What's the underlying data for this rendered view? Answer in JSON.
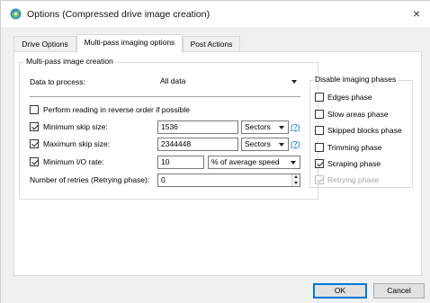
{
  "window": {
    "title": "Options (Compressed drive image creation)",
    "close_glyph": "×",
    "icon": "app-icon"
  },
  "tabs": [
    {
      "label": "Drive Options",
      "active": false
    },
    {
      "label": "Multi-pass imaging options",
      "active": true
    },
    {
      "label": "Post Actions",
      "active": false
    }
  ],
  "multipass": {
    "group_title": "Multi-pass image creation",
    "data_to_process_label": "Data to process:",
    "data_to_process_value": "All data",
    "reverse_order_label": "Perform reading in reverse order if possible",
    "reverse_order_checked": false,
    "min_skip": {
      "label": "Minimum skip size:",
      "checked": true,
      "value": "1536",
      "unit": "Sectors",
      "help": "(?)"
    },
    "max_skip": {
      "label": "Maximum skip size:",
      "checked": true,
      "value": "2344448",
      "unit": "Sectors",
      "help": "(?)"
    },
    "min_io": {
      "label": "Minimum I/O rate:",
      "checked": true,
      "value": "10",
      "unit": "% of average speed"
    },
    "retries": {
      "label": "Number of retries (Retrying phase):",
      "value": "0"
    }
  },
  "phases": {
    "group_title": "Disable imaging phases",
    "items": [
      {
        "label": "Edges phase",
        "checked": false,
        "enabled": true
      },
      {
        "label": "Slow areas phase",
        "checked": false,
        "enabled": true
      },
      {
        "label": "Skipped blocks phase",
        "checked": false,
        "enabled": true
      },
      {
        "label": "Trimming phase",
        "checked": false,
        "enabled": true
      },
      {
        "label": "Scraping phase",
        "checked": true,
        "enabled": true
      },
      {
        "label": "Retrying phase",
        "checked": true,
        "enabled": false
      }
    ]
  },
  "buttons": {
    "ok": "OK",
    "cancel": "Cancel"
  },
  "colors": {
    "accent": "#0078d7",
    "link": "#0066cc",
    "dialog_bg": "#f0f0f0"
  }
}
